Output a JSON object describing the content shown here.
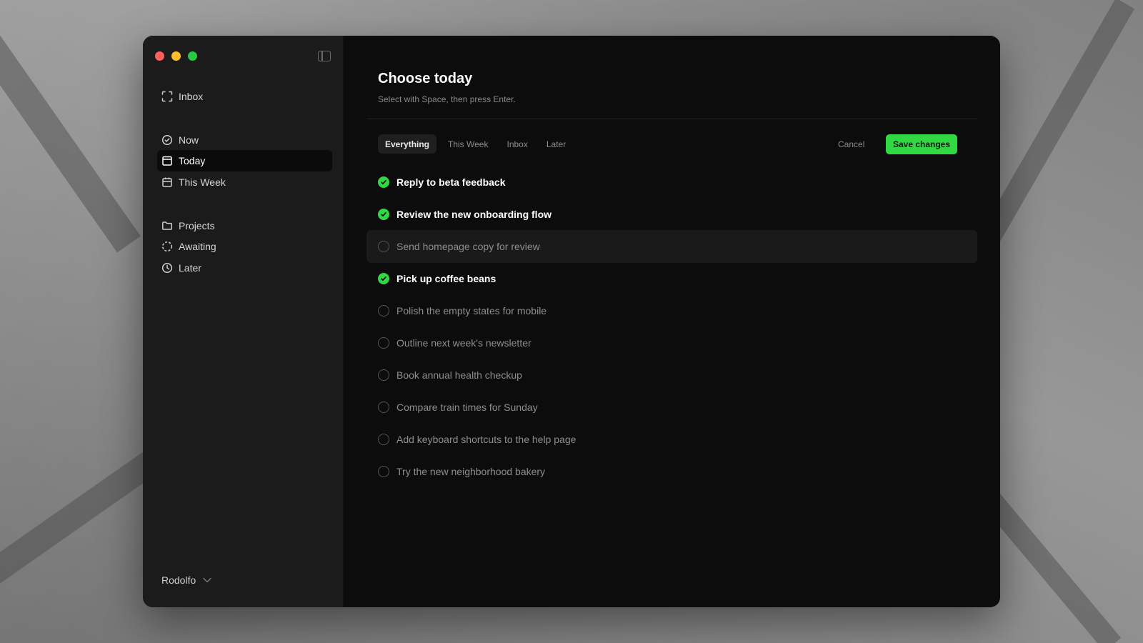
{
  "colors": {
    "accent": "#31d843",
    "sidebar_bg": "#1b1b1b",
    "main_bg": "#0c0c0c"
  },
  "sidebar": {
    "inbox": {
      "label": "Inbox",
      "icon": "inbox-icon"
    },
    "group1": [
      {
        "label": "Now",
        "icon": "check-circle-icon"
      },
      {
        "label": "Today",
        "icon": "calendar-today-icon",
        "active": true
      },
      {
        "label": "This Week",
        "icon": "calendar-week-icon"
      }
    ],
    "group2": [
      {
        "label": "Projects",
        "icon": "folder-icon"
      },
      {
        "label": "Awaiting",
        "icon": "dashed-circle-icon"
      },
      {
        "label": "Later",
        "icon": "clock-icon"
      }
    ],
    "user": {
      "name": "Rodolfo",
      "icon": "chevron-down-icon"
    }
  },
  "main": {
    "title": "Choose today",
    "subtitle": "Select with Space, then press Enter.",
    "tabs": [
      {
        "label": "Everything",
        "active": true
      },
      {
        "label": "This Week"
      },
      {
        "label": "Inbox"
      },
      {
        "label": "Later"
      }
    ],
    "cancel_label": "Cancel",
    "save_label": "Save changes",
    "tasks": [
      {
        "label": "Reply to beta feedback",
        "selected": true
      },
      {
        "label": "Review the new onboarding flow",
        "selected": true
      },
      {
        "label": "Send homepage copy for review",
        "selected": false,
        "highlighted": true
      },
      {
        "label": "Pick up coffee beans",
        "selected": true
      },
      {
        "label": "Polish the empty states for mobile",
        "selected": false
      },
      {
        "label": "Outline next week's newsletter",
        "selected": false
      },
      {
        "label": "Book annual health checkup",
        "selected": false
      },
      {
        "label": "Compare train times for Sunday",
        "selected": false
      },
      {
        "label": "Add keyboard shortcuts to the help page",
        "selected": false
      },
      {
        "label": "Try the new neighborhood bakery",
        "selected": false
      }
    ]
  }
}
